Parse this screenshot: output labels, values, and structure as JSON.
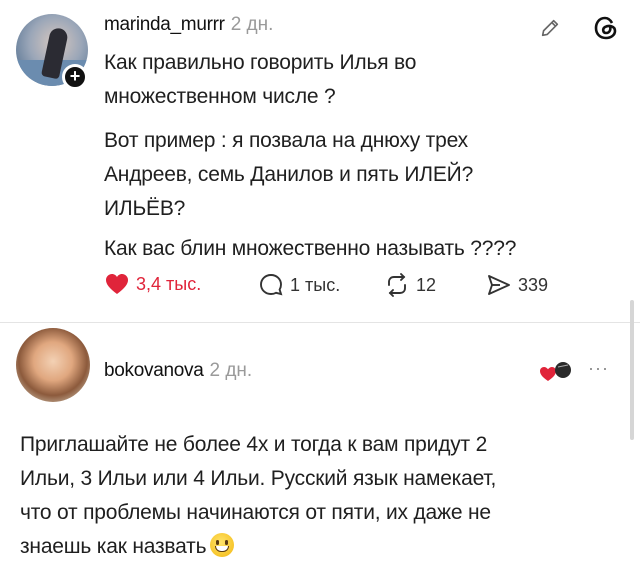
{
  "post": {
    "username": "marinda_murrr",
    "time_ago": "2 дн.",
    "lines": [
      "Как правильно говорить Илья во",
      "множественном числе ?",
      "Вот пример : я позвала на днюху трех",
      "Андреев, семь Данилов и пять ИЛЕЙ?",
      "ИЛЬЁВ?",
      "Как вас блин множественно называть ????"
    ],
    "likes": "3,4 тыс.",
    "replies": "1 тыс.",
    "reposts": "12",
    "shares": "339"
  },
  "reply": {
    "username": "bokovanova",
    "time_ago": "2 дн.",
    "lines": [
      "Приглашайте не более 4х и тогда к вам придут 2",
      "Ильи, 3 Ильи или 4 Ильи. Русский язык намекает,",
      "что от проблемы начинаются от пяти, их даже не",
      "знаешь как назвать"
    ],
    "more_label": "···"
  },
  "colors": {
    "like": "#e0243a",
    "muted": "#9a9a9a",
    "text": "#1f1f1f"
  },
  "icons": [
    "pencil-icon",
    "threads-logo-icon",
    "heart-icon",
    "reply-bubble-icon",
    "repost-icon",
    "share-icon",
    "reaction-heart-icon",
    "more-icon",
    "smile-emoji-icon"
  ]
}
